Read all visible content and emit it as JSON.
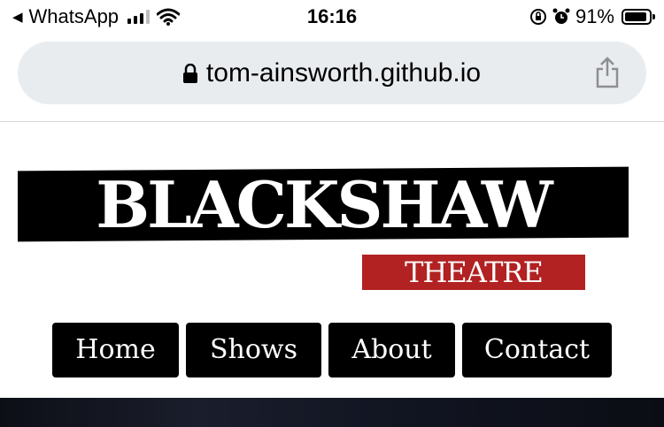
{
  "status_bar": {
    "back_app": "WhatsApp",
    "time": "16:16",
    "battery_percent": "91%",
    "battery_level": 0.91,
    "icons": [
      "back-caret-icon",
      "cellular-signal-icon",
      "wifi-icon",
      "orientation-lock-icon",
      "alarm-icon",
      "battery-icon"
    ]
  },
  "browser": {
    "url": "tom-ainsworth.github.io",
    "icons": [
      "lock-icon",
      "share-icon"
    ]
  },
  "site": {
    "logo_main": "BLACKSHAW",
    "logo_sub": "THEATRE",
    "colors": {
      "logo_background": "#000000",
      "theatre_banner": "#b22222",
      "nav_background": "#000000",
      "nav_text": "#ffffff"
    }
  },
  "nav": {
    "items": [
      {
        "label": "Home"
      },
      {
        "label": "Shows"
      },
      {
        "label": "About"
      },
      {
        "label": "Contact"
      }
    ]
  }
}
